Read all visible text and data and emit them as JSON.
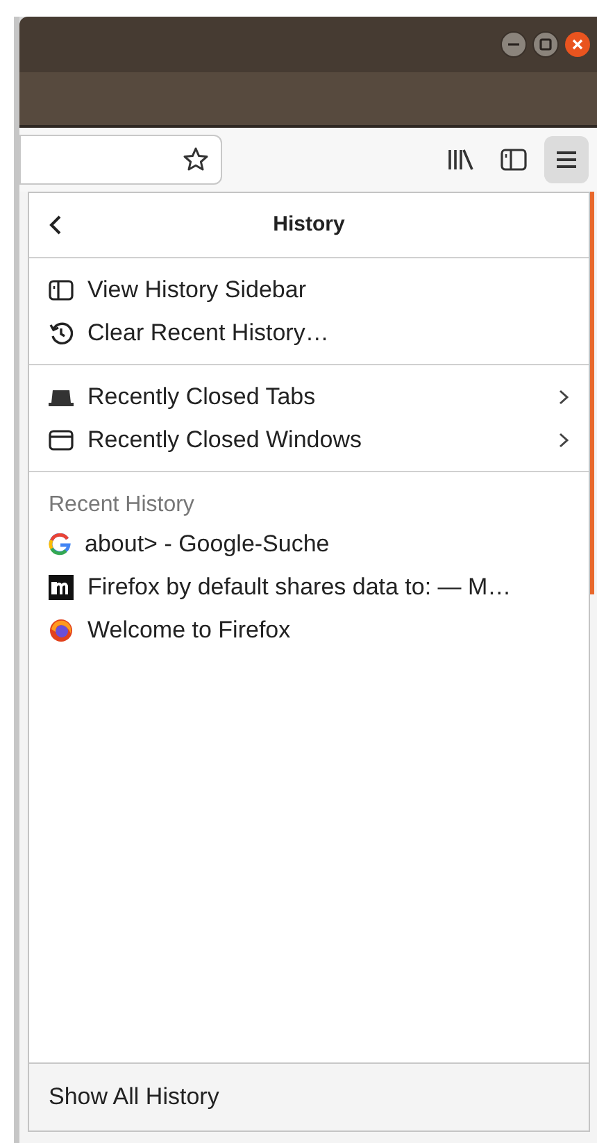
{
  "panel": {
    "title": "History",
    "actions": [
      {
        "label": "View History Sidebar"
      },
      {
        "label": "Clear Recent History…"
      }
    ],
    "submenus": [
      {
        "label": "Recently Closed Tabs",
        "expandable": true
      },
      {
        "label": "Recently Closed Windows",
        "expandable": true
      }
    ],
    "recent_history": {
      "heading": "Recent History",
      "items": [
        {
          "label": "about> - Google-Suche"
        },
        {
          "label": "Firefox by default shares data to: — M…"
        },
        {
          "label": "Welcome to Firefox"
        }
      ]
    },
    "footer": {
      "label": "Show All History"
    }
  }
}
